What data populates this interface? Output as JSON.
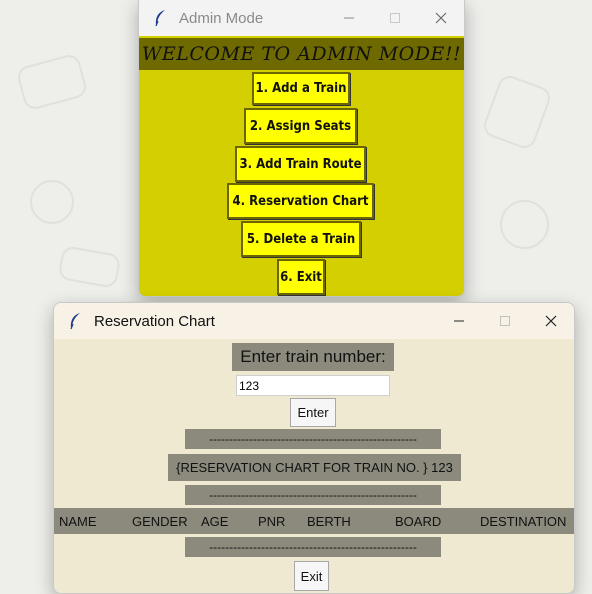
{
  "admin_window": {
    "title": "Admin Mode",
    "welcome": "WELCOME TO ADMIN MODE!!",
    "buttons": [
      "1. Add a Train",
      "2. Assign Seats",
      "3. Add Train Route",
      "4. Reservation Chart",
      "5. Delete a Train",
      "6. Exit"
    ]
  },
  "reservation_window": {
    "title": "Reservation Chart",
    "prompt": "Enter train number:",
    "train_input_value": "123",
    "enter_label": "Enter",
    "divider": "----------------------------------------------------",
    "chart_heading": "{RESERVATION CHART FOR TRAIN NO. } 123",
    "columns": [
      "NAME",
      "GENDER",
      "AGE",
      "PNR",
      "BERTH",
      "BOARD",
      "DESTINATION"
    ],
    "exit_label": "Exit"
  },
  "colors": {
    "admin_bg": "#d4cf00",
    "admin_button": "#ffff00",
    "welcome_bar": "#6e6a00",
    "chart_bg": "#efe9d1",
    "chart_label": "#8c8a7d"
  },
  "icons": {
    "app": "feather-icon",
    "minimize": "minimize-icon",
    "maximize": "maximize-icon",
    "close": "close-icon"
  }
}
